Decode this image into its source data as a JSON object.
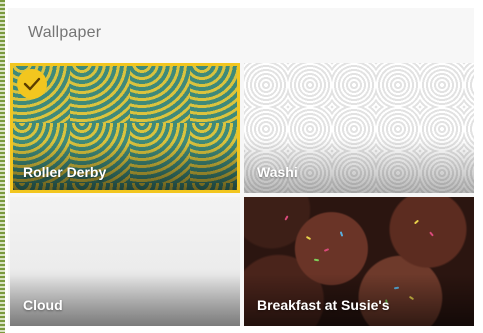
{
  "panel": {
    "title": "Wallpaper"
  },
  "wallpapers": [
    {
      "name": "Roller Derby",
      "selected": true
    },
    {
      "name": "Washi",
      "selected": false
    },
    {
      "name": "Cloud",
      "selected": false
    },
    {
      "name": "Breakfast at Susie's",
      "selected": false
    }
  ],
  "colors": {
    "selection_accent": "#f2c61f",
    "header_text": "#757575",
    "tile_label": "#ffffff"
  },
  "icons": {
    "selected_indicator": "checkmark-icon"
  }
}
